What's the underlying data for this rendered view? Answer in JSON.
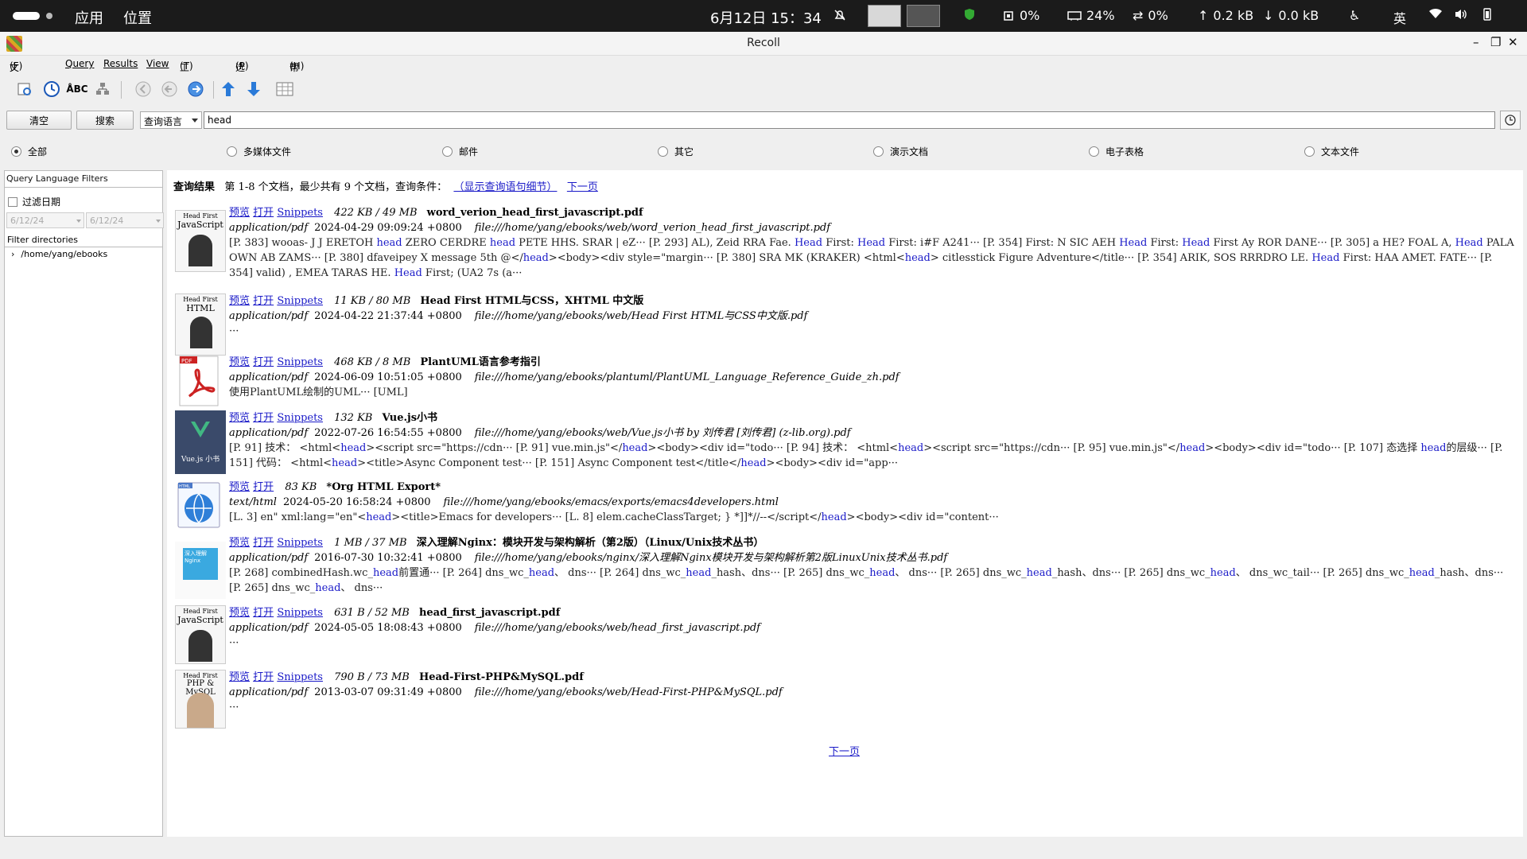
{
  "topbar": {
    "apps": "应用",
    "places": "位置",
    "datetime": "6月12日  15：34",
    "cpu": "0%",
    "mem": "24%",
    "swap": "0%",
    "up": "0.2 kB",
    "down": "0.0 kB",
    "ime": "英"
  },
  "window": {
    "title": "Recoll"
  },
  "menu": [
    {
      "label": "文件",
      "key": "(F)"
    },
    {
      "label": "Query",
      "key": ""
    },
    {
      "label": "Results",
      "key": ""
    },
    {
      "label": "View",
      "key": ""
    },
    {
      "label": "工具",
      "key": "(T)"
    },
    {
      "label": "选项",
      "key": "(P)"
    },
    {
      "label": "帮助",
      "key": "(H)"
    }
  ],
  "search": {
    "clear_label": "清空",
    "search_label": "搜索",
    "mode": "查询语言",
    "query": "head"
  },
  "filters": {
    "all": "全部",
    "media": "多媒体文件",
    "mail": "邮件",
    "other": "其它",
    "presentation": "演示文档",
    "spreadsheet": "电子表格",
    "text": "文本文件"
  },
  "sidebar": {
    "header": "Query Language Filters",
    "date_filter": "过滤日期",
    "date_from": "6/12/24",
    "date_to": "6/12/24",
    "dir_header": "Filter directories",
    "dir": "/home/yang/ebooks"
  },
  "results": {
    "heading": "查询结果",
    "summary": "第 1-8 个文档，最少共有 9 个文档，查询条件：",
    "show_query": "（显示查询语句细节）",
    "next": "下一页",
    "preview": "预览",
    "open": "打开",
    "snippets": "Snippets",
    "items": [
      {
        "size": "422 KB / 49 MB",
        "title": "word_verion_head_first_javascript.pdf",
        "mime": "application/pdf",
        "date": "2024-04-29 09:09:24 +0800",
        "path": "file:///home/yang/ebooks/web/word_verion_head_first_javascript.pdf",
        "snip1": "[P. 383] wooas- J J ERETOH ",
        "snip2": " ZERO CERDRE ",
        "snip3": " PETE HHS. SRAR | eZ··· [P. 293] AL), Zeid RRA Fae. ",
        "snip4": " First: ",
        "snip5": " First: i#F A241··· [P. 354] First: N SIC AEH ",
        "snip6": " First: ",
        "snip7": " First Ay ROR DANE··· [P. 305] a HE? FOAL A, ",
        "snip8": " PALA OWN AB ZAMS··· [P. 380] dfaveipey X message 5th @</",
        "snip9": "><body><div style=\"margin··· [P. 380] SRA MK (KRAKER) <html<",
        "snip10": "> citlesstick Figure Adventure</title··· [P. 354] ARIK, SOS RRRDRO LE. ",
        "snip11": " First: HAA AMET. FATE··· [P. 354] valid) , EMEA TARAS HE. ",
        "snip12": " First; (UA2 7s (a···",
        "w_head": "head",
        "w_Head": "Head",
        "thumb_top": "Head First",
        "thumb_title": "JavaScript"
      },
      {
        "size": "11 KB / 80 MB",
        "title": "Head First HTML与CSS，XHTML 中文版",
        "mime": "application/pdf",
        "date": "2024-04-22 21:37:44 +0800",
        "path": "file:///home/yang/ebooks/web/Head First HTML与CSS中文版.pdf",
        "snip": "···",
        "thumb_top": "Head First",
        "thumb_title": "HTML"
      },
      {
        "size": "468 KB / 8 MB",
        "title": "PlantUML语言参考指引",
        "mime": "application/pdf",
        "date": "2024-06-09 10:51:05 +0800",
        "path": "file:///home/yang/ebooks/plantuml/PlantUML_Language_Reference_Guide_zh.pdf",
        "snip": "使用PlantUML绘制的UML··· [UML]",
        "thumb_label": "PDF"
      },
      {
        "size": "132 KB",
        "title": "Vue.js小书",
        "mime": "application/pdf",
        "date": "2022-07-26 16:54:55 +0800",
        "path": "file:///home/yang/ebooks/web/Vue.js小书 by 刘传君 [刘传君] (z-lib.org).pdf",
        "s1": "[P. 91] 技术：  <html<",
        "s2": "><script src=\"https://cdn··· [P. 91] vue.min.js\"</",
        "s3": "><body><div id=\"todo··· [P. 94] 技术：  <html<",
        "s4": "><script src=\"https://cdn··· [P. 95] vue.min.js\"</",
        "s5": "><body><div id=\"todo··· [P. 107] 态选择 ",
        "s6": "的层级··· [P. 151] 代码：",
        "s7": "<html<",
        "s8": "><title>Async Component test··· [P. 151] Async Component test</title</",
        "s9": "><body><div id=\"app···",
        "w_head": "head",
        "thumb_label": "Vue.js 小书"
      },
      {
        "size": "83 KB",
        "title": "*Org HTML Export*",
        "mime": "text/html",
        "date": "2024-05-20 16:58:24 +0800",
        "path": "file:///home/yang/ebooks/emacs/exports/emacs4developers.html",
        "s1": "[L. 3] en\" xml:lang=\"en\"<",
        "s2": "><title>Emacs for developers··· [L. 8] elem.cacheClassTarget; } *]]*//--</script</",
        "s3": "><body><div id=\"content···",
        "w_head": "head",
        "thumb_label": "HTML"
      },
      {
        "size": "1 MB / 37 MB",
        "title": "深入理解Nginx：模块开发与架构解析（第2版）（Linux/Unix技术丛书）",
        "mime": "application/pdf",
        "date": "2016-07-30 10:32:41 +0800",
        "path": "file:///home/yang/ebooks/nginx/深入理解Nginx模块开发与架构解析第2版LinuxUnix技术丛书.pdf",
        "s1": "[P. 268] combinedHash.wc_",
        "s2": "前置通··· [P. 264] dns_wc_",
        "s3": "、 dns··· [P. 264] dns_wc_",
        "s4": "_hash、dns··· [P. 265] dns_wc_",
        "s5": "、 dns··· [P. 265] dns_wc_",
        "s6": "_hash、dns··· [P. 265] dns_wc_",
        "s7": "、 dns_wc_tail··· [P. 265] dns_wc_",
        "s8": "_hash、dns··· [P. 265]",
        "s9": "dns_wc_",
        "s10": "、 dns···",
        "w_head": "head",
        "thumb_label": "深入理解Nginx"
      },
      {
        "size": "631 B / 52 MB",
        "title": "head_first_javascript.pdf",
        "mime": "application/pdf",
        "date": "2024-05-05 18:08:43 +0800",
        "path": "file:///home/yang/ebooks/web/head_first_javascript.pdf",
        "snip": "···",
        "thumb_top": "Head First",
        "thumb_title": "JavaScript"
      },
      {
        "size": "790 B / 73 MB",
        "title": "Head-First-PHP&MySQL.pdf",
        "mime": "application/pdf",
        "date": "2013-03-07 09:31:49 +0800",
        "path": "file:///home/yang/ebooks/web/Head-First-PHP&MySQL.pdf",
        "snip": "···",
        "thumb_top": "Head First",
        "thumb_title": "PHP & MySQL"
      }
    ]
  }
}
